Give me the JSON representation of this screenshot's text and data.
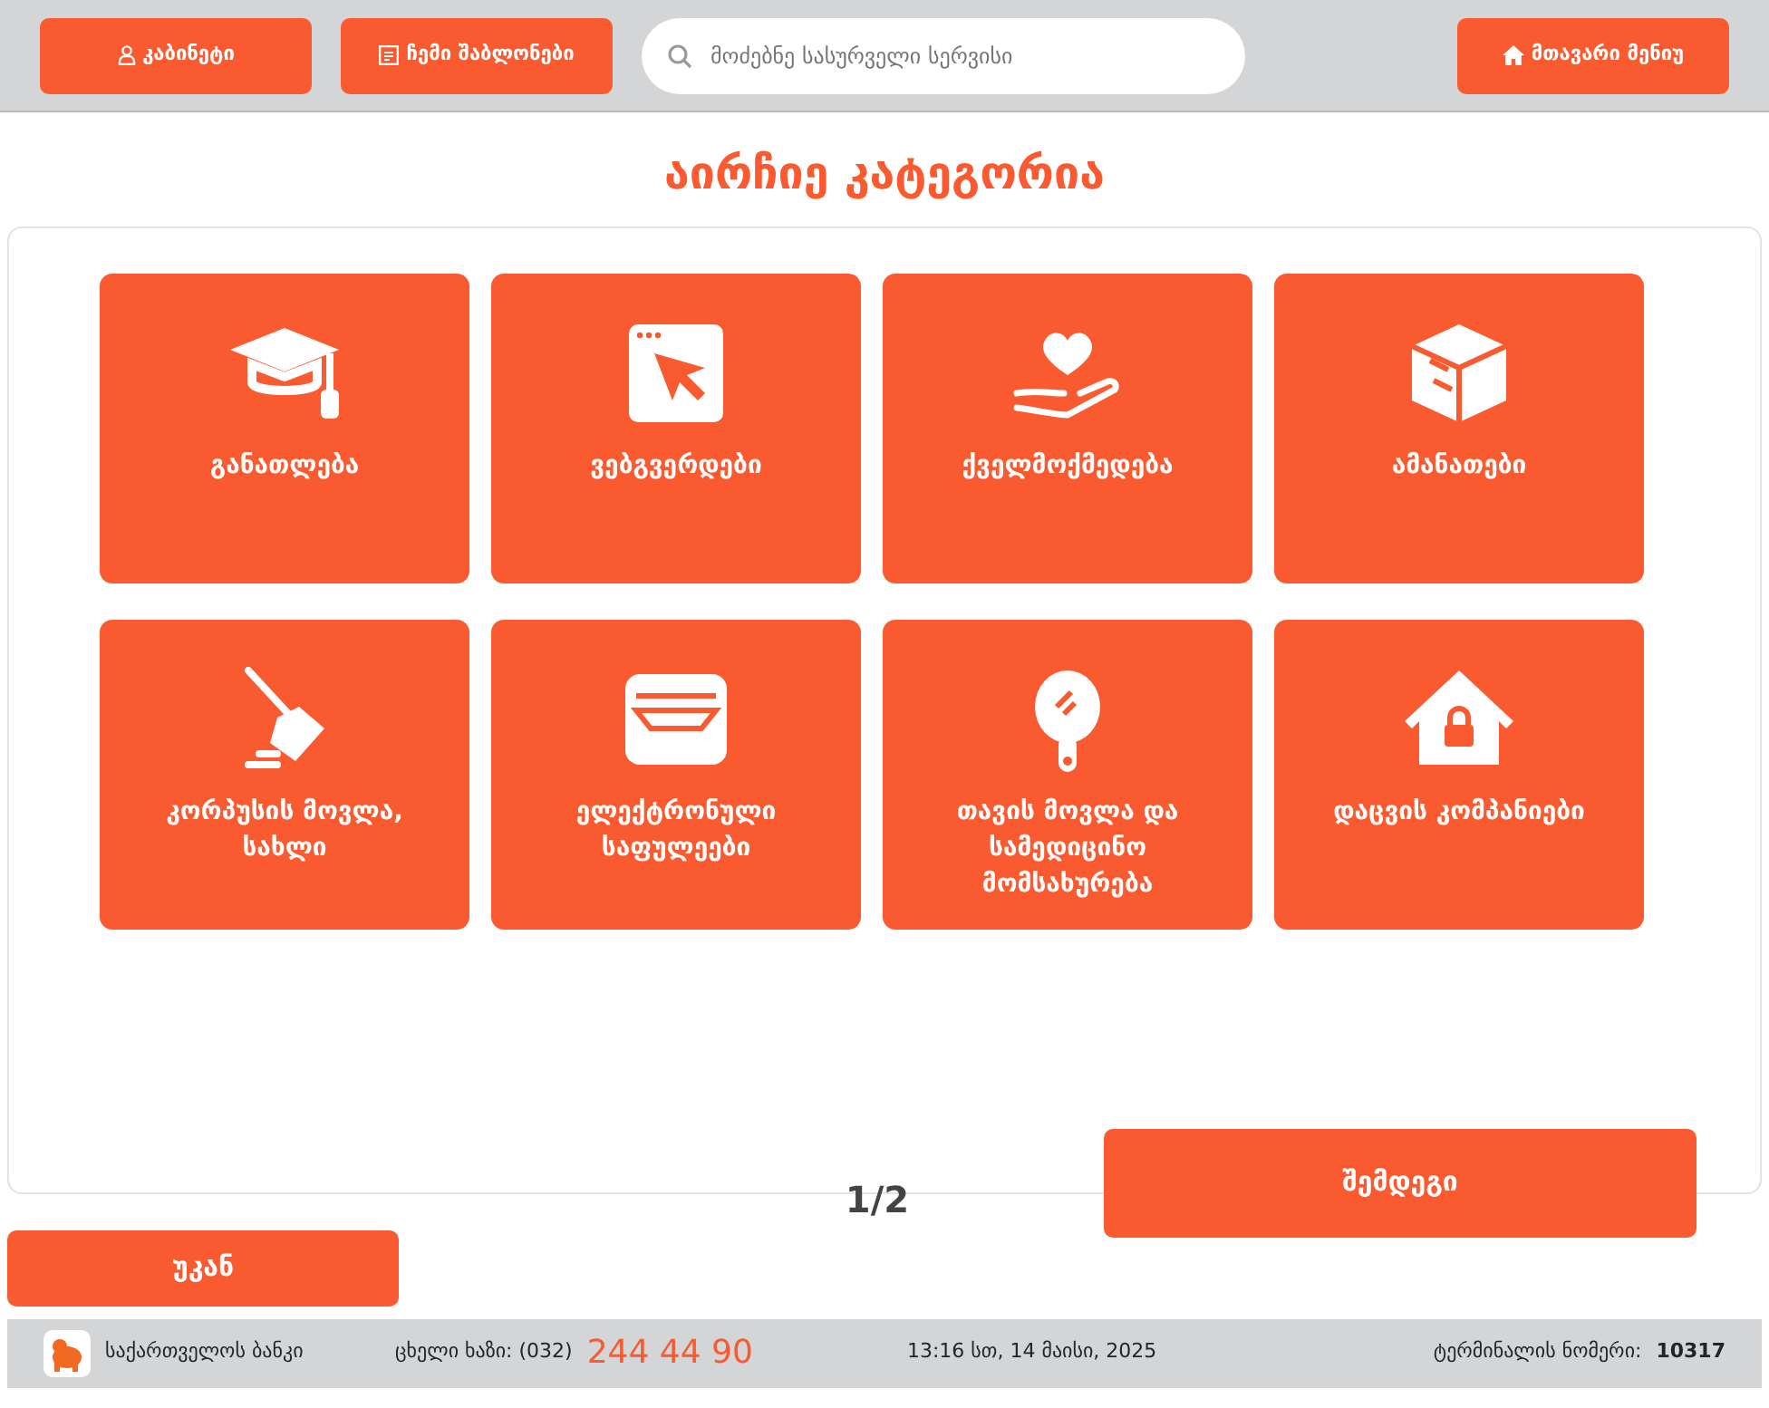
{
  "top_bar": {
    "cabinet_button": "კაბინეტი",
    "templates_button": "ჩემი შაბლონები",
    "search": {
      "placeholder": "მოძებნე სასურველი სერვისი"
    },
    "main_menu_button": "მთავარი მენიუ"
  },
  "title": "აირჩიე კატეგორია",
  "categories": [
    {
      "label": "განათლება"
    },
    {
      "label": "ვებგვერდები"
    },
    {
      "label": "ქველმოქმედება"
    },
    {
      "label": "ამანათები"
    },
    {
      "label": "კორპუსის მოვლა, სახლი"
    },
    {
      "label": "ელექტრონული საფულეები"
    },
    {
      "label": "თავის მოვლა და სამედიცინო მომსახურება"
    },
    {
      "label": "დაცვის კომპანიები"
    }
  ],
  "pager": "1/2",
  "next_button": "შემდეგი",
  "back_button": "უკან",
  "footer": {
    "bank": "საქართველოს ბანკი",
    "hotline_label": "ცხელი ხაზი: (032)",
    "hotline_number": "244 44 90",
    "datetime": "13:16 სთ, 14 მაისი, 2025",
    "terminal_label": "ტერმინალის ნომერი:",
    "terminal_number": "10317"
  }
}
